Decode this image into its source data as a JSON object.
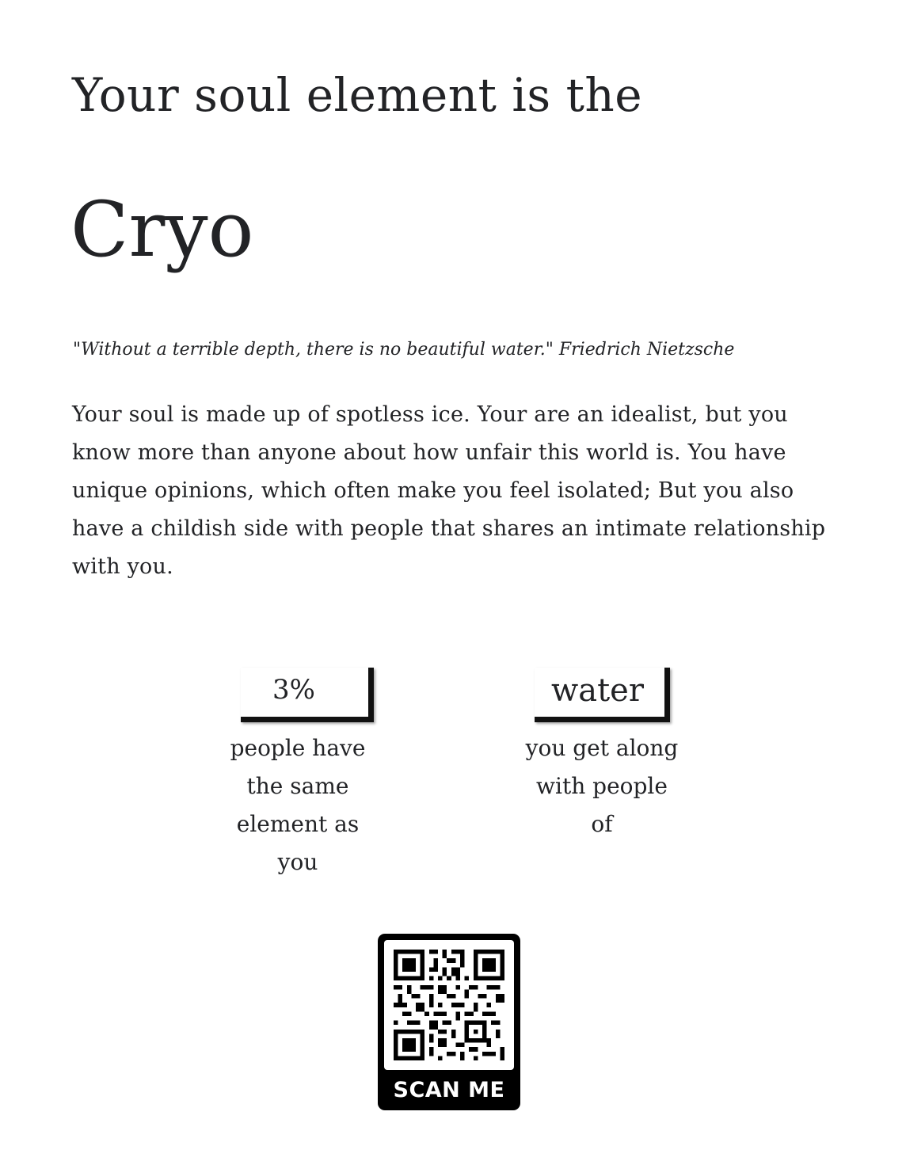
{
  "header": {
    "intro": "Your soul element is the",
    "element": "Cryo"
  },
  "quote": "\"Without a terrible depth, there is no beautiful water.\" Friedrich Nietzsche",
  "description": "Your soul is made up of spotless ice. Your are an idealist, but you know more than anyone about how unfair this world is. You have unique opinions, which often make you feel isolated; But you also have a childish side with people that shares an intimate relationship with you.",
  "stats": [
    {
      "value": "3%",
      "caption": "people have the same element as you"
    },
    {
      "value": "water",
      "caption": "you get along with people of"
    }
  ],
  "qr": {
    "label": "SCAN ME"
  }
}
